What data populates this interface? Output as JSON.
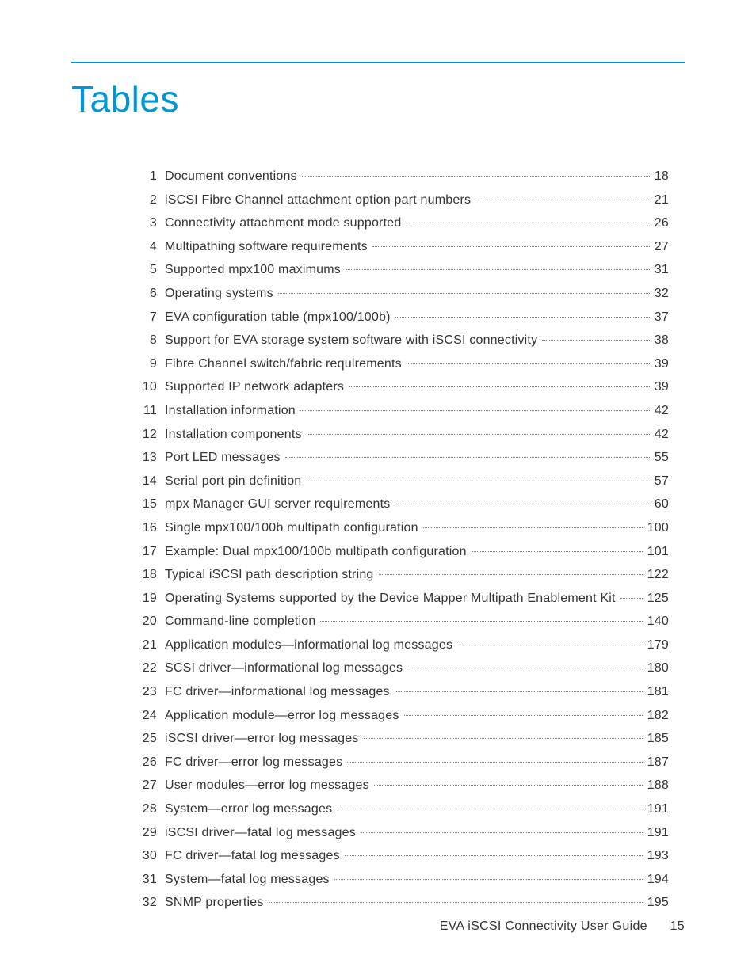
{
  "title": "Tables",
  "toc": [
    {
      "n": "1",
      "label": "Document conventions",
      "page": "18"
    },
    {
      "n": "2",
      "label": "iSCSI Fibre Channel attachment option part numbers",
      "page": "21"
    },
    {
      "n": "3",
      "label": "Connectivity attachment mode supported",
      "page": "26"
    },
    {
      "n": "4",
      "label": "Multipathing software requirements",
      "page": "27"
    },
    {
      "n": "5",
      "label": "Supported mpx100 maximums",
      "page": "31"
    },
    {
      "n": "6",
      "label": "Operating systems",
      "page": "32"
    },
    {
      "n": "7",
      "label": "EVA configuration table (mpx100/100b)",
      "page": "37"
    },
    {
      "n": "8",
      "label": "Support for EVA storage system software with iSCSI connectivity",
      "page": "38"
    },
    {
      "n": "9",
      "label": "Fibre Channel switch/fabric requirements",
      "page": "39"
    },
    {
      "n": "10",
      "label": "Supported IP network adapters",
      "page": "39"
    },
    {
      "n": "11",
      "label": "Installation information",
      "page": "42"
    },
    {
      "n": "12",
      "label": "Installation components",
      "page": "42"
    },
    {
      "n": "13",
      "label": "Port LED messages",
      "page": "55"
    },
    {
      "n": "14",
      "label": "Serial port pin definition",
      "page": "57"
    },
    {
      "n": "15",
      "label": "mpx Manager GUI server requirements",
      "page": "60"
    },
    {
      "n": "16",
      "label": "Single mpx100/100b multipath configuration",
      "page": "100"
    },
    {
      "n": "17",
      "label": "Example: Dual mpx100/100b multipath configuration",
      "page": "101"
    },
    {
      "n": "18",
      "label": "Typical iSCSI path description string",
      "page": "122"
    },
    {
      "n": "19",
      "label": "Operating Systems supported by the Device Mapper Multipath Enablement Kit",
      "page": "125"
    },
    {
      "n": "20",
      "label": "Command-line completion",
      "page": "140"
    },
    {
      "n": "21",
      "label": "Application modules—informational log messages",
      "page": "179"
    },
    {
      "n": "22",
      "label": "SCSI driver—informational log messages",
      "page": "180"
    },
    {
      "n": "23",
      "label": "FC driver—informational log messages",
      "page": "181"
    },
    {
      "n": "24",
      "label": "Application module—error log messages",
      "page": "182"
    },
    {
      "n": "25",
      "label": "iSCSI driver—error log messages",
      "page": "185"
    },
    {
      "n": "26",
      "label": "FC driver—error log messages",
      "page": "187"
    },
    {
      "n": "27",
      "label": "User modules—error log messages",
      "page": "188"
    },
    {
      "n": "28",
      "label": "System—error log messages",
      "page": "191"
    },
    {
      "n": "29",
      "label": "iSCSI driver—fatal log messages",
      "page": "191"
    },
    {
      "n": "30",
      "label": "FC driver—fatal log messages",
      "page": "193"
    },
    {
      "n": "31",
      "label": "System—fatal log messages",
      "page": "194"
    },
    {
      "n": "32",
      "label": "SNMP properties",
      "page": "195"
    }
  ],
  "footer": {
    "doc": "EVA iSCSI Connectivity User Guide",
    "page": "15"
  }
}
